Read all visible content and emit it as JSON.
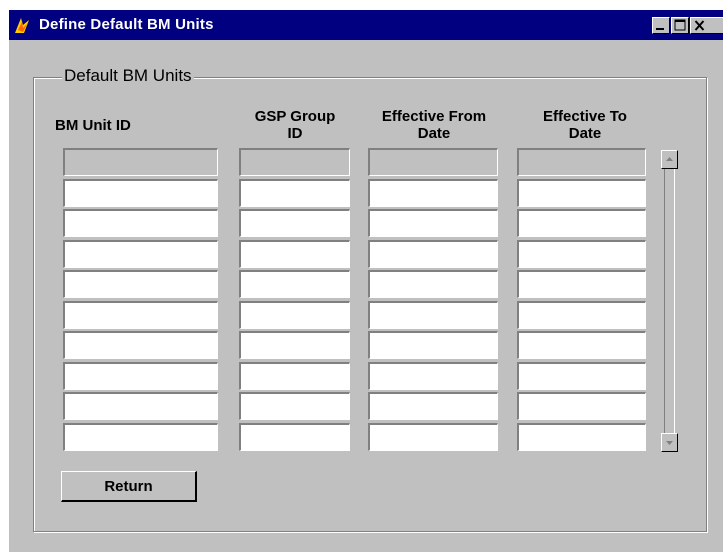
{
  "window": {
    "title": "Define Default BM Units",
    "title_bar_color": "#000080",
    "app_icon": "oracle-forms-app-icon",
    "controls": [
      "minimize-icon",
      "maximize-icon",
      "close-icon"
    ]
  },
  "group": {
    "label": "Default BM Units"
  },
  "table": {
    "columns": [
      {
        "line1": "BM Unit ID",
        "line2": ""
      },
      {
        "line1": "GSP Group",
        "line2": "ID"
      },
      {
        "line1": "Effective From",
        "line2": "Date"
      },
      {
        "line1": "Effective To",
        "line2": "Date"
      }
    ],
    "rows": [
      [
        "",
        "",
        "",
        ""
      ],
      [
        "",
        "",
        "",
        ""
      ],
      [
        "",
        "",
        "",
        ""
      ],
      [
        "",
        "",
        "",
        ""
      ],
      [
        "",
        "",
        "",
        ""
      ],
      [
        "",
        "",
        "",
        ""
      ],
      [
        "",
        "",
        "",
        ""
      ],
      [
        "",
        "",
        "",
        ""
      ],
      [
        "",
        "",
        "",
        ""
      ],
      [
        "",
        "",
        "",
        ""
      ]
    ]
  },
  "scrollbar": {
    "up_icon": "scroll-up-icon",
    "down_icon": "scroll-down-icon"
  },
  "buttons": {
    "return_label": "Return"
  }
}
